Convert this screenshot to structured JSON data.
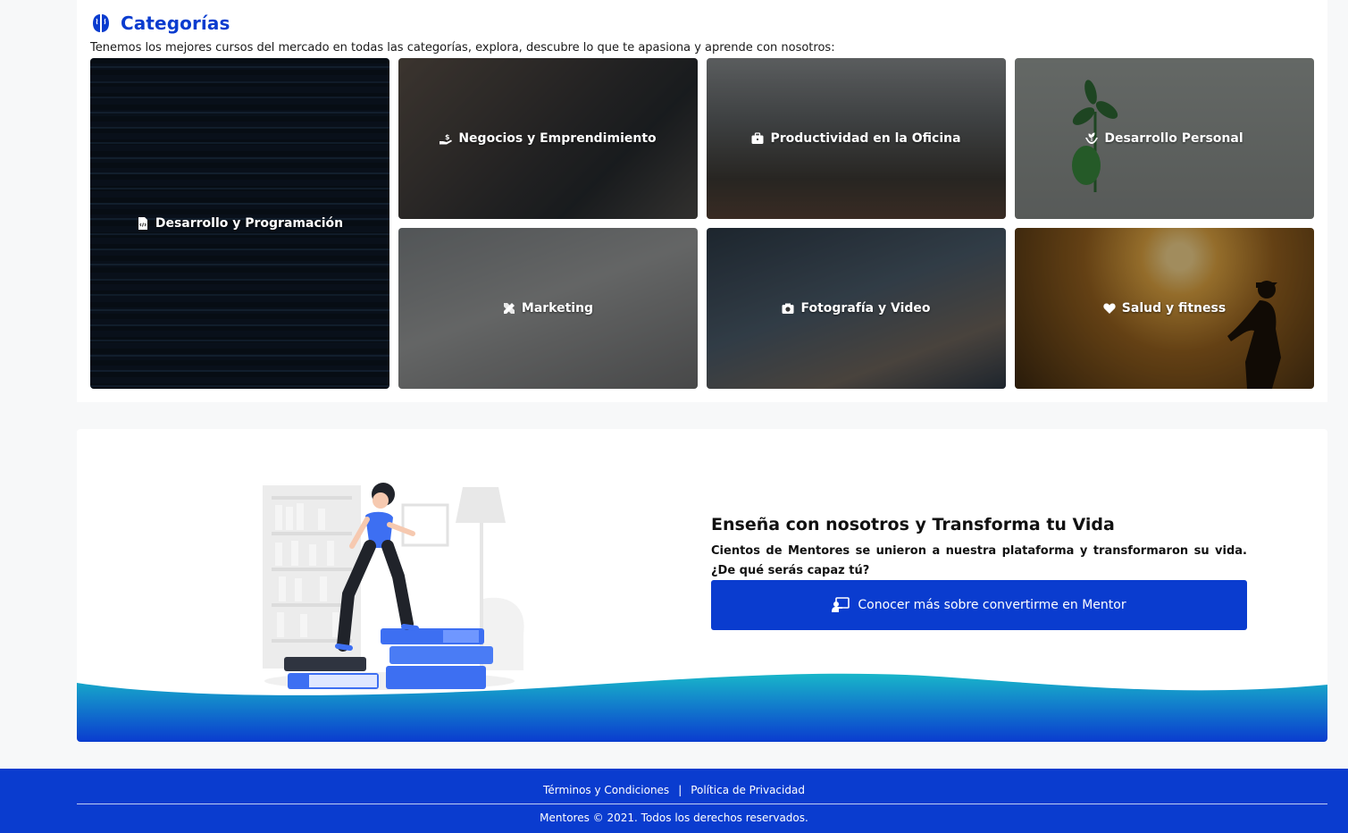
{
  "categories": {
    "title": "Categorías",
    "description": "Tenemos los mejores cursos del mercado en todas las categorías, explora, descubre lo que te apasiona y aprende con nosotros:",
    "items": [
      {
        "label": "Desarrollo y Programación",
        "icon": "file-code-icon"
      },
      {
        "label": "Negocios y Emprendimiento",
        "icon": "hand-coin-icon"
      },
      {
        "label": "Productividad en la Oficina",
        "icon": "briefcase-icon"
      },
      {
        "label": "Desarrollo Personal",
        "icon": "seedling-hands-icon"
      },
      {
        "label": "Marketing",
        "icon": "pencil-ruler-icon"
      },
      {
        "label": "Fotografía y Video",
        "icon": "camera-icon"
      },
      {
        "label": "Salud y fitness",
        "icon": "heart-icon"
      }
    ]
  },
  "teach": {
    "title": "Enseña con nosotros y Transforma tu Vida",
    "text": "Cientos de Mentores se unieron a nuestra plataforma y transformaron su vida. ¿De qué serás capaz tú?",
    "button_label": "Conocer más sobre convertirme en Mentor",
    "button_icon": "chalkboard-teacher-icon"
  },
  "footer": {
    "terms": "Términos y Condiciones",
    "separator": "|",
    "privacy": "Política de Privacidad",
    "copyright": "Mentores © 2021. Todos los derechos reservados."
  },
  "colors": {
    "primary": "#0a3ccf",
    "wave_top": "#19b6c9",
    "wave_bottom": "#0a3ccf"
  }
}
